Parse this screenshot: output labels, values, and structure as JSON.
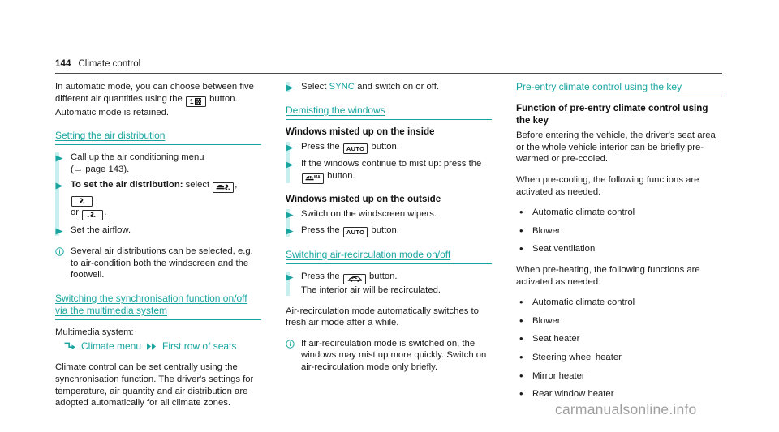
{
  "header": {
    "page_number": "144",
    "title": "Climate control"
  },
  "watermark": "carmanualsonline.info",
  "colors": {
    "teal": "#18A5A0",
    "pale_teal_bar": "#C8EFEF",
    "text": "#1a1a1a",
    "watermark": "#9e9e9e"
  },
  "columns": {
    "left": {
      "intro_paragraph": "In automatic mode, you can choose between five different air quantities using the  button. Automatic mode is retained.",
      "intro_part1": "In automatic mode, you can choose between five different air quantities using the",
      "intro_part2": "button.",
      "intro_part3": "Automatic mode is retained.",
      "section1": {
        "heading": "Setting the air distribution",
        "steps": [
          {
            "text": "Call up the air conditioning menu",
            "xref": "(→ page 143)."
          },
          {
            "bold_lead": "To set the air distribution:",
            "text": "select",
            "text_cont": "or"
          },
          {
            "text": "Set the airflow."
          }
        ],
        "note": "Several air distributions can be selected, e.g. to air-condition both the windscreen and the footwell."
      },
      "section2": {
        "heading": "Switching the synchronisation function on/off via the multimedia system",
        "lead": "Multimedia system:",
        "path_first": "Climate menu",
        "path_second": "First row of seats",
        "body": "Climate control can be set centrally using the synchronisation function. The driver's settings for temperature, air quantity and air distribution are adopted automatically for all climate zones."
      }
    },
    "middle": {
      "top_step": {
        "prefix": "Select",
        "term": "SYNC",
        "suffix": "and switch on or off."
      },
      "section1": {
        "heading": "Demisting the windows",
        "sub1": "Windows misted up on the inside",
        "steps1": [
          {
            "pre": "Press the",
            "post": "button.",
            "key": "AUTO"
          },
          {
            "pre": "If the windows continue to mist up: press the",
            "post": "button.",
            "key": "MAX-DEFROST"
          }
        ],
        "sub2": "Windows misted up on the outside",
        "steps2": [
          {
            "text": "Switch on the windscreen wipers."
          },
          {
            "pre": "Press the",
            "post": "button.",
            "key": "AUTO"
          }
        ]
      },
      "section2": {
        "heading": "Switching air-recirculation mode on/off",
        "step": {
          "pre": "Press the",
          "post": "button.",
          "key": "AIR-RECIRCULATION",
          "second_line": "The interior air will be recirculated."
        },
        "body": "Air-recirculation mode automatically switches to fresh air mode after a while.",
        "note": "If air-recirculation mode is switched on, the windows may mist up more quickly. Switch on air-recirculation mode only briefly."
      }
    },
    "right": {
      "heading": "Pre-entry climate control using the key",
      "sub": "Function of pre-entry climate control using the key",
      "para1": "Before entering the vehicle, the driver's seat area or the whole vehicle interior can be briefly pre-warmed or pre-cooled.",
      "para2": "When pre-cooling, the following functions are activated as needed:",
      "list1": [
        "Automatic climate control",
        "Blower",
        "Seat ventilation"
      ],
      "para3": "When pre-heating, the following functions are activated as needed:",
      "list2": [
        "Automatic climate control",
        "Blower",
        "Seat heater",
        "Steering wheel heater",
        "Mirror heater",
        "Rear window heater"
      ]
    }
  },
  "icons": {
    "step_arrow": "triangle-right-icon",
    "info": "info-circle-icon",
    "air_quantity_button": "air-quantity-button-icon",
    "air_dist_windscreen": "air-distribution-windscreen-icon",
    "air_dist_centre": "air-distribution-centre-icon",
    "air_dist_footwell": "air-distribution-footwell-icon",
    "auto_button": "auto-button-icon",
    "max_defrost_button": "max-defrost-button-icon",
    "recirculation_button": "air-recirculation-button-icon",
    "mm_enter": "multimedia-enter-arrow-icon",
    "mm_next": "multimedia-double-arrow-icon"
  }
}
